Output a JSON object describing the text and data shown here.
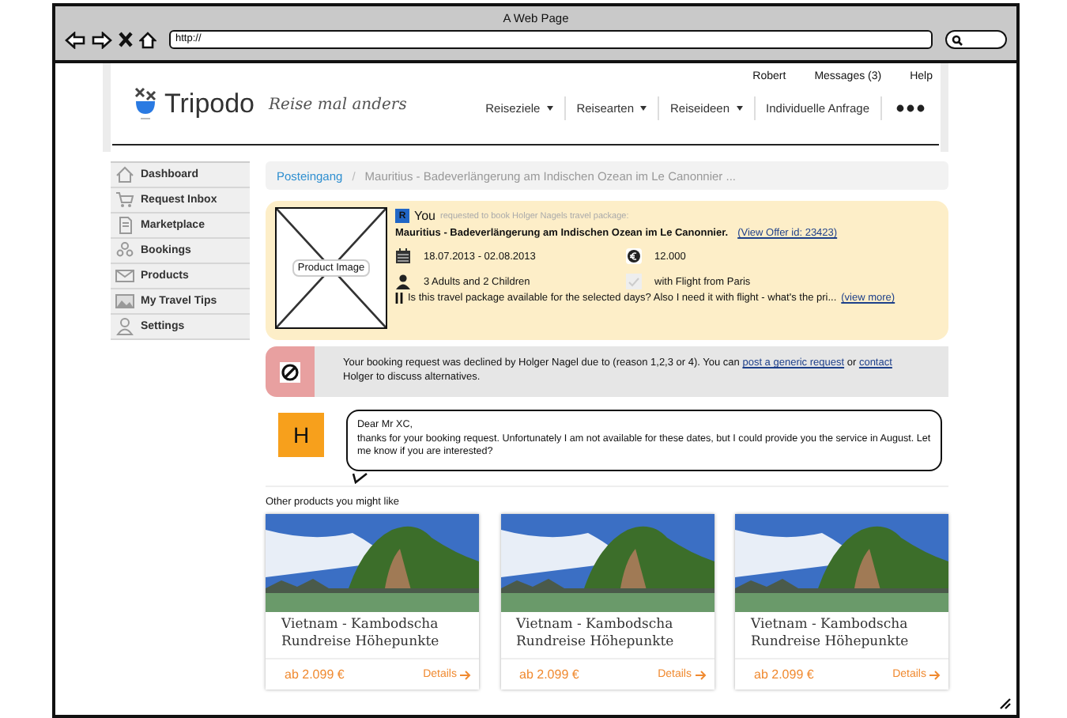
{
  "window": {
    "title": "A Web Page",
    "address": "http://"
  },
  "header": {
    "logo": "Tripodo",
    "tagline": "Reise mal anders",
    "top_links": [
      "Robert",
      "Messages (3)",
      "Help"
    ],
    "nav": [
      {
        "label": "Reiseziele",
        "dropdown": true
      },
      {
        "label": "Reisearten",
        "dropdown": true
      },
      {
        "label": "Reiseideen",
        "dropdown": true
      },
      {
        "label": "Individuelle Anfrage",
        "dropdown": false
      }
    ]
  },
  "sidebar": {
    "items": [
      {
        "label": "Dashboard",
        "selected": false
      },
      {
        "label": "Request Inbox",
        "selected": false
      },
      {
        "label": "Marketplace",
        "selected": false
      },
      {
        "label": "Bookings",
        "selected": false
      },
      {
        "label": "Products",
        "selected": false
      },
      {
        "label": "My Travel Tips",
        "selected": false
      },
      {
        "label": "Settings",
        "selected": false
      }
    ]
  },
  "breadcrumb": {
    "separator": "/",
    "items": [
      "Posteingang",
      "Mauritius - Badeverlängerung am Indischen Ozean im Le Canonnier ..."
    ]
  },
  "request": {
    "image_label": "Product Image",
    "avatar": "R",
    "sender": "You",
    "action": "requested to book Holger Nagels travel package:",
    "title": "Mauritius - Badeverlängerung am Indischen Ozean im Le Canonnier.",
    "offer_link": "(View Offer id: 23423)",
    "dates": "18.07.2013 - 02.08.2013",
    "price": "12.000",
    "travelers": "3 Adults and 2 Children",
    "flight": "with Flight from Paris",
    "message": "Is this travel package available for the selected days? Also I need it with flight - what's the pri...",
    "more_link": "(view more)"
  },
  "notice": {
    "parts": [
      {
        "kind": "text",
        "text": "Your booking request was declined by Holger Nagel due to (reason 1,2,3 or 4). You can"
      },
      {
        "kind": "link",
        "text": "post a generic request"
      },
      {
        "kind": "text",
        "text": "or"
      },
      {
        "kind": "link",
        "text": "contact"
      },
      {
        "kind": "text",
        "text": "Holger to discuss alternatives."
      }
    ]
  },
  "reply": {
    "avatar": "H",
    "greeting": "Dear Mr XC,",
    "body": "thanks for your booking request. Unfortunately I am not available for these dates, but I could provide you the service in August. Let me know if you are interested?"
  },
  "recommendations": {
    "heading": "Other products you might like",
    "products": [
      {
        "title": "Vietnam - Kambodscha Rundreise Höhepunkte",
        "price": "ab 2.099 €",
        "details": "Details"
      },
      {
        "title": "Vietnam - Kambodscha Rundreise Höhepunkte",
        "price": "ab 2.099 €",
        "details": "Details"
      },
      {
        "title": "Vietnam - Kambodscha Rundreise Höhepunkte",
        "price": "ab 2.099 €",
        "details": "Details"
      }
    ]
  }
}
